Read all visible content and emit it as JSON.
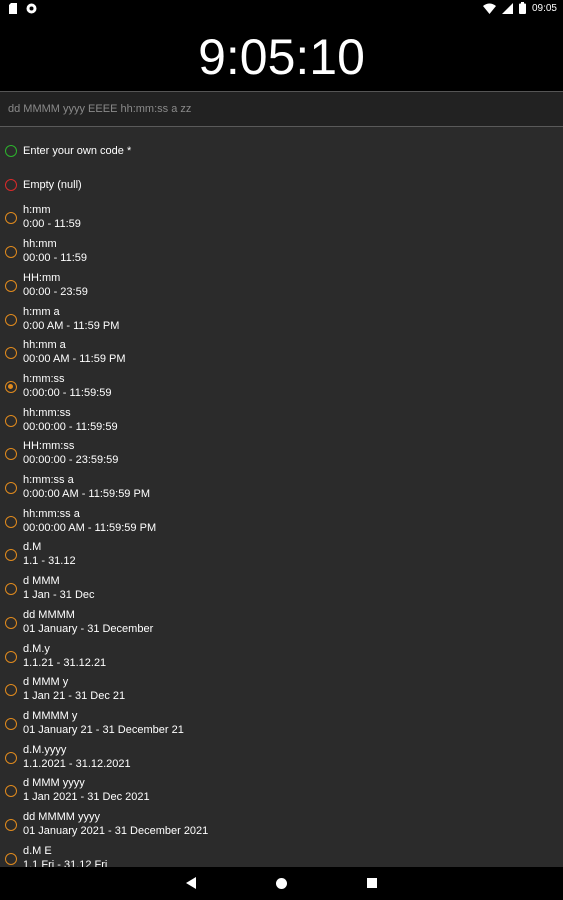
{
  "statusbar": {
    "time": "09:05"
  },
  "clock": {
    "time": "9:05:10"
  },
  "format": {
    "pattern": "dd MMMM yyyy EEEE hh:mm:ss a zz"
  },
  "colors": {
    "accent": "#e08a1e",
    "custom": "#2db32d",
    "empty": "#d92a2a"
  },
  "options": [
    {
      "code": "Enter your own code *",
      "kind": "custom"
    },
    {
      "code": "Empty (null)",
      "kind": "empty"
    },
    {
      "code": "h:mm",
      "range": "0:00 - 11:59"
    },
    {
      "code": "hh:mm",
      "range": "00:00 - 11:59"
    },
    {
      "code": "HH:mm",
      "range": "00:00 - 23:59"
    },
    {
      "code": "h:mm a",
      "range": "0:00 AM - 11:59 PM"
    },
    {
      "code": "hh:mm a",
      "range": "00:00 AM - 11:59 PM"
    },
    {
      "code": "h:mm:ss",
      "range": "0:00:00 - 11:59:59",
      "selected": true
    },
    {
      "code": "hh:mm:ss",
      "range": "00:00:00 - 11:59:59"
    },
    {
      "code": "HH:mm:ss",
      "range": "00:00:00 - 23:59:59"
    },
    {
      "code": "h:mm:ss a",
      "range": "0:00:00 AM - 11:59:59 PM"
    },
    {
      "code": "hh:mm:ss a",
      "range": "00:00:00 AM - 11:59:59 PM"
    },
    {
      "code": "d.M",
      "range": "1.1 - 31.12"
    },
    {
      "code": "d MMM",
      "range": "1 Jan - 31 Dec"
    },
    {
      "code": "dd MMMM",
      "range": "01 January - 31 December"
    },
    {
      "code": "d.M.y",
      "range": "1.1.21 - 31.12.21"
    },
    {
      "code": "d MMM y",
      "range": "1 Jan 21 - 31 Dec 21"
    },
    {
      "code": "d MMMM y",
      "range": "01 January 21 - 31 December 21"
    },
    {
      "code": "d.M.yyyy",
      "range": "1.1.2021 - 31.12.2021"
    },
    {
      "code": "d MMM yyyy",
      "range": "1 Jan 2021 - 31 Dec 2021"
    },
    {
      "code": "dd MMMM yyyy",
      "range": "01 January 2021 - 31 December 2021"
    },
    {
      "code": "d.M E",
      "range": "1.1 Fri - 31.12 Fri"
    }
  ]
}
